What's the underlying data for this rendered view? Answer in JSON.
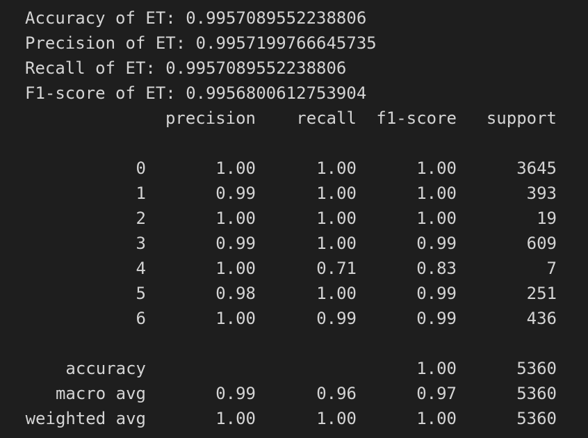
{
  "metrics": [
    "Accuracy of ET: 0.9957089552238806",
    "Precision of ET: 0.9957199766645735",
    "Recall of ET: 0.9957089552238806",
    "F1-score of ET: 0.9956800612753904"
  ],
  "report": {
    "headers": {
      "precision": "precision",
      "recall": "recall",
      "f1": "f1-score",
      "support": "support"
    },
    "rows": [
      {
        "label": "0",
        "precision": "1.00",
        "recall": "1.00",
        "f1": "1.00",
        "support": "3645"
      },
      {
        "label": "1",
        "precision": "0.99",
        "recall": "1.00",
        "f1": "1.00",
        "support": "393"
      },
      {
        "label": "2",
        "precision": "1.00",
        "recall": "1.00",
        "f1": "1.00",
        "support": "19"
      },
      {
        "label": "3",
        "precision": "0.99",
        "recall": "1.00",
        "f1": "0.99",
        "support": "609"
      },
      {
        "label": "4",
        "precision": "1.00",
        "recall": "0.71",
        "f1": "0.83",
        "support": "7"
      },
      {
        "label": "5",
        "precision": "0.98",
        "recall": "1.00",
        "f1": "0.99",
        "support": "251"
      },
      {
        "label": "6",
        "precision": "1.00",
        "recall": "0.99",
        "f1": "0.99",
        "support": "436"
      }
    ],
    "summary": [
      {
        "label": "accuracy",
        "precision": "",
        "recall": "",
        "f1": "1.00",
        "support": "5360"
      },
      {
        "label": "macro avg",
        "precision": "0.99",
        "recall": "0.96",
        "f1": "0.97",
        "support": "5360"
      },
      {
        "label": "weighted avg",
        "precision": "1.00",
        "recall": "1.00",
        "f1": "1.00",
        "support": "5360"
      }
    ]
  }
}
